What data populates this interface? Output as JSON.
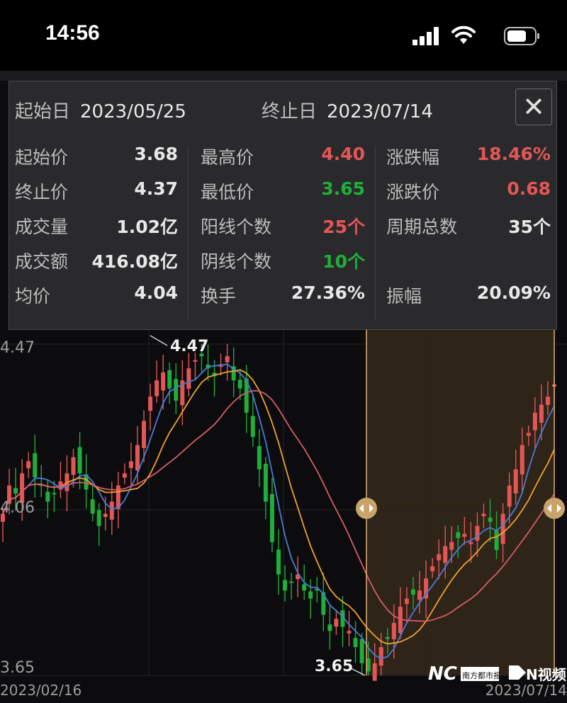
{
  "status_bar": {
    "time": "14:56"
  },
  "popup": {
    "start_date_label": "起始日",
    "start_date": "2023/05/25",
    "end_date_label": "终止日",
    "end_date": "2023/07/14",
    "close_label": "✕",
    "columns": [
      [
        {
          "label": "起始价",
          "value": "3.68",
          "color": ""
        },
        {
          "label": "终止价",
          "value": "4.37",
          "color": ""
        },
        {
          "label": "成交量",
          "value": "1.02亿",
          "color": ""
        },
        {
          "label": "成交额",
          "value": "416.08亿",
          "color": ""
        },
        {
          "label": "均价",
          "value": "4.04",
          "color": ""
        }
      ],
      [
        {
          "label": "最高价",
          "value": "4.40",
          "color": "red"
        },
        {
          "label": "最低价",
          "value": "3.65",
          "color": "green"
        },
        {
          "label": "阳线个数",
          "value": "25个",
          "color": "red"
        },
        {
          "label": "阴线个数",
          "value": "10个",
          "color": "green"
        },
        {
          "label": "换手",
          "value": "27.36%",
          "color": ""
        }
      ],
      [
        {
          "label": "涨跌幅",
          "value": "18.46%",
          "color": "red"
        },
        {
          "label": "涨跌价",
          "value": "0.68",
          "color": "red"
        },
        {
          "label": "周期总数",
          "value": "35个",
          "color": ""
        },
        {
          "label": "",
          "value": "",
          "color": ""
        },
        {
          "label": "振幅",
          "value": "20.09%",
          "color": ""
        }
      ]
    ]
  },
  "chart_data": {
    "type": "candlestick",
    "y_axis_labels": [
      "4.47",
      "4.06",
      "3.65"
    ],
    "x_axis_labels": [
      "2023/02/16",
      "2023/07/14"
    ],
    "annotations": {
      "high": "4.47",
      "low": "3.65"
    },
    "ylim": [
      3.65,
      4.47
    ],
    "selection": {
      "start": "2023/05/25",
      "end": "2023/07/14"
    },
    "colors": {
      "up": "#e45656",
      "down": "#1fae3a",
      "ma5": "#4a7bd8",
      "ma10": "#f0a030",
      "ma20": "#d85a6a",
      "selection": "#e0b070"
    },
    "closes": [
      4.05,
      4.12,
      4.1,
      4.15,
      4.18,
      4.14,
      4.12,
      4.08,
      4.1,
      4.13,
      4.15,
      4.19,
      4.15,
      4.11,
      4.05,
      4.02,
      4.05,
      4.08,
      4.12,
      4.15,
      4.18,
      4.22,
      4.28,
      4.34,
      4.38,
      4.4,
      4.36,
      4.33,
      4.38,
      4.41,
      4.43,
      4.44,
      4.41,
      4.39,
      4.42,
      4.44,
      4.38,
      4.36,
      4.3,
      4.24,
      4.16,
      4.08,
      3.98,
      3.9,
      3.86,
      3.88,
      3.9,
      3.86,
      3.84,
      3.86,
      3.8,
      3.76,
      3.79,
      3.77,
      3.76,
      3.72,
      3.68,
      3.66,
      3.68,
      3.72,
      3.74,
      3.78,
      3.82,
      3.84,
      3.85,
      3.86,
      3.89,
      3.92,
      3.95,
      3.97,
      3.98,
      3.99,
      4.0,
      3.98,
      4.02,
      4.05,
      4.03,
      3.96,
      4.05,
      4.12,
      4.16,
      4.22,
      4.25,
      4.3,
      4.32,
      4.34,
      4.37
    ]
  },
  "watermark": {
    "brand": "NC",
    "sub": "南方都市报",
    "video": "N视频"
  }
}
